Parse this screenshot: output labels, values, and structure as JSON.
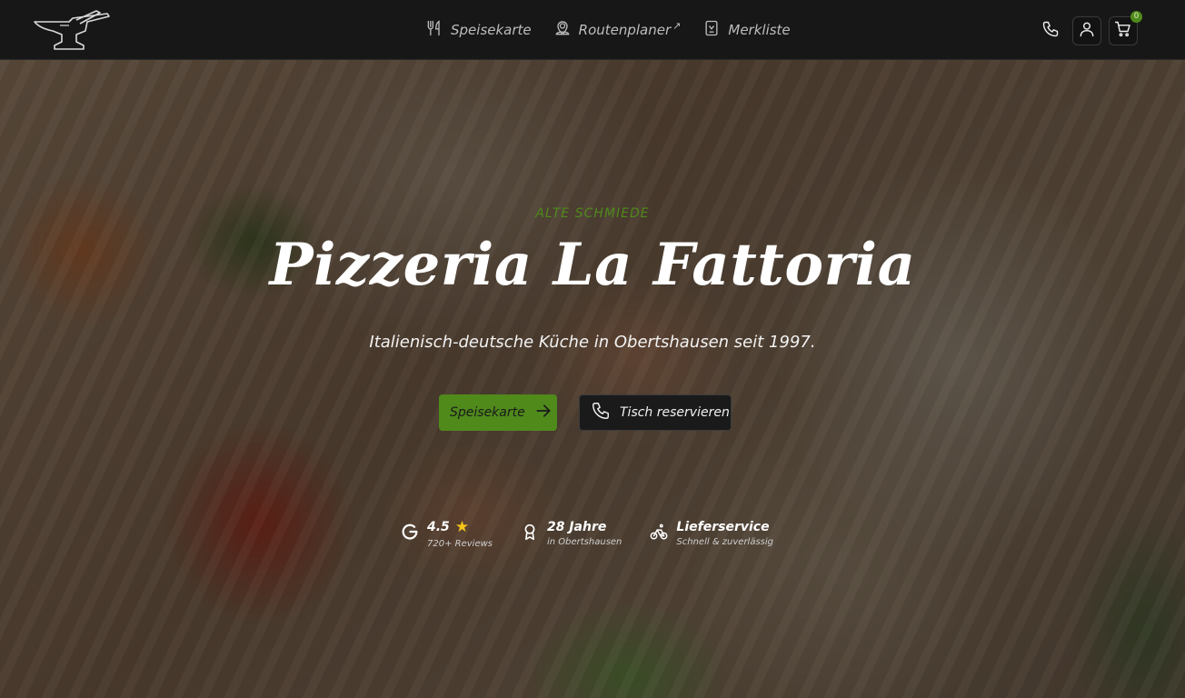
{
  "nav": {
    "items": [
      {
        "label": "Speisekarte",
        "icon": "fork-knife-icon"
      },
      {
        "label": "Routenplaner",
        "icon": "map-pin-icon",
        "external": true
      },
      {
        "label": "Merkliste",
        "icon": "bookmark-list-icon"
      }
    ]
  },
  "header": {
    "cart_count": "0"
  },
  "hero": {
    "eyebrow": "ALTE SCHMIEDE",
    "title": "Pizzeria La Fattoria",
    "subtitle": "Italienisch-deutsche Küche in Obertshausen seit 1997.",
    "cta_menu": "Speisekarte",
    "cta_reserve": "Tisch reservieren"
  },
  "stats": [
    {
      "value": "4.5",
      "label": "720+ Reviews",
      "icon": "google-icon"
    },
    {
      "value": "28 Jahre",
      "label": "in Obertshausen",
      "icon": "award-icon"
    },
    {
      "value": "Lieferservice",
      "label": "Schnell & zuverlässig",
      "icon": "bicycle-icon"
    }
  ],
  "colors": {
    "accent": "#4f8a1b",
    "header_bg": "#171717",
    "star": "#f5c518"
  }
}
